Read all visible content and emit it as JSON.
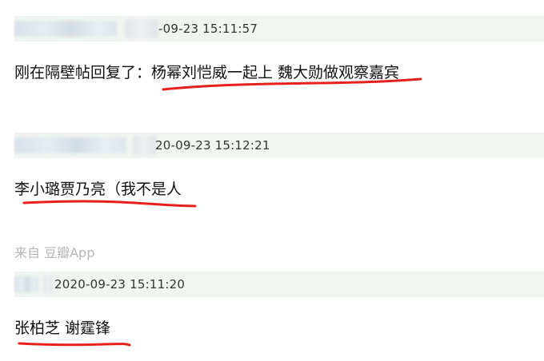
{
  "comments": [
    {
      "timestamp": "-09-23 15:11:57",
      "text": "刚在隔壁帖回复了：杨幂刘恺威一起上 魏大勋做观察嘉宾"
    },
    {
      "timestamp": "20-09-23 15:12:21",
      "text": "李小璐贾乃亮（我不是人"
    },
    {
      "timestamp": "2020-09-23 15:11:20",
      "text": "张柏芝 谢霆锋"
    }
  ],
  "source_label": "来自 豆瓣App",
  "colors": {
    "meta_bar_background": "#f0f5f0",
    "underline": "#e8201c",
    "source_text": "#b5b5b5"
  }
}
